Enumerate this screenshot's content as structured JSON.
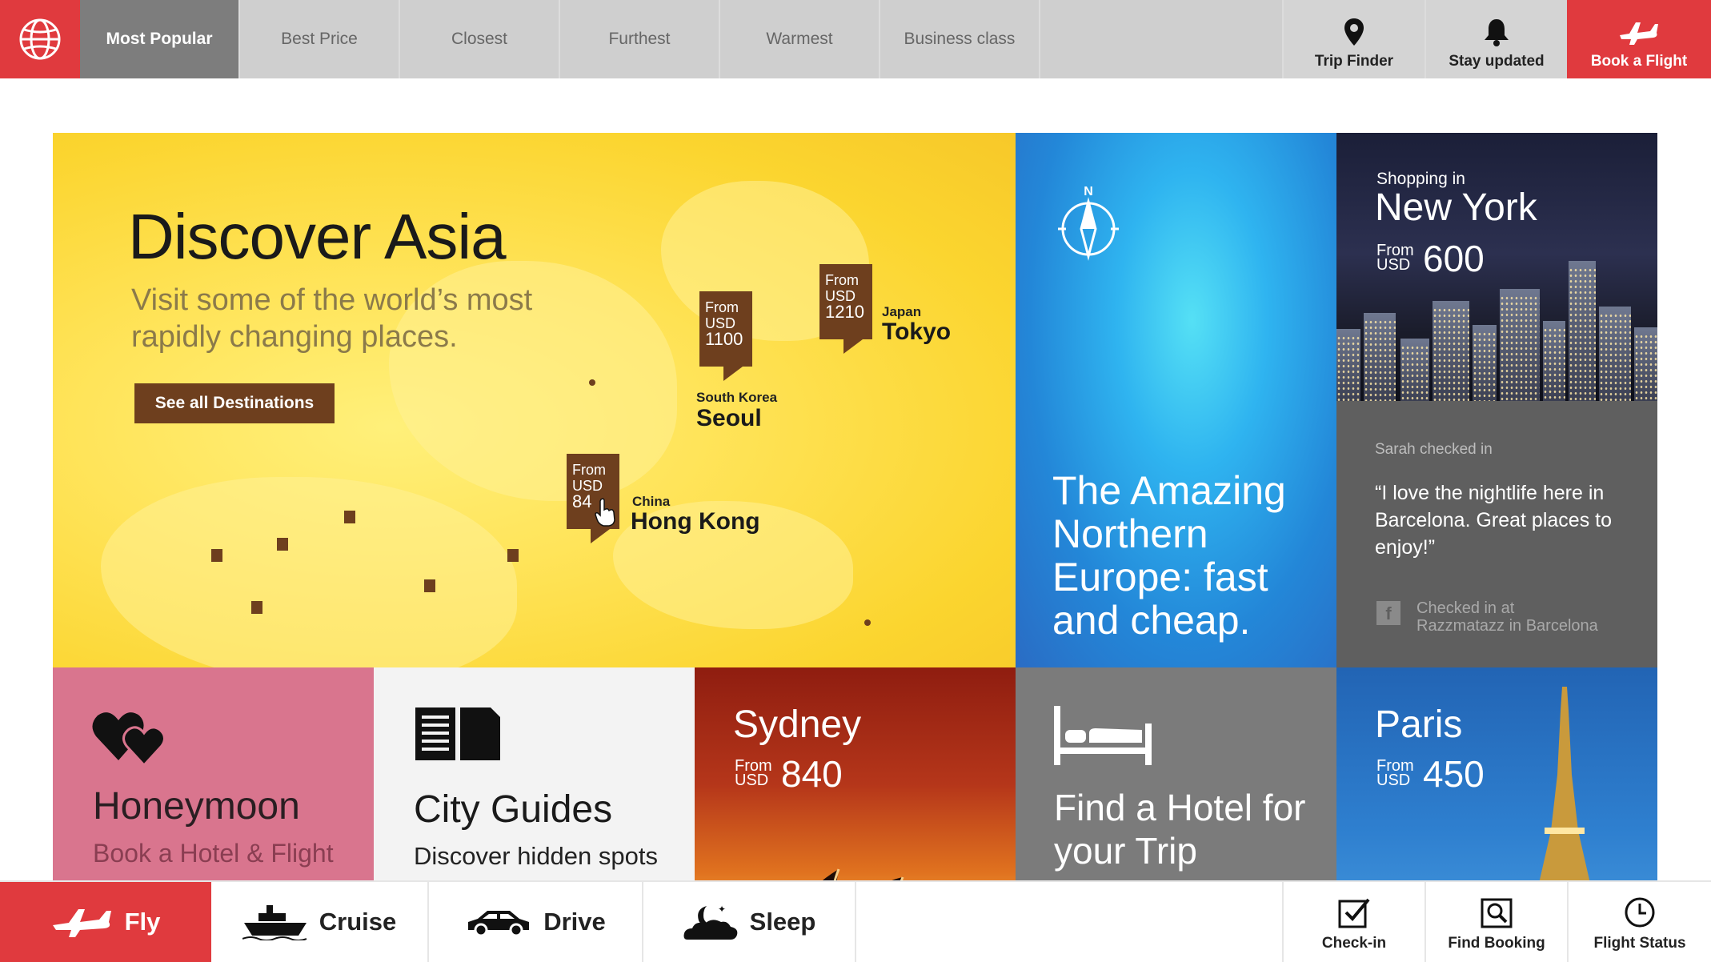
{
  "topbar": {
    "tabs": [
      {
        "label": "Most Popular",
        "active": true
      },
      {
        "label": "Best Price"
      },
      {
        "label": "Closest"
      },
      {
        "label": "Furthest"
      },
      {
        "label": "Warmest"
      },
      {
        "label": "Business class"
      }
    ],
    "utilities": [
      {
        "label": "Trip Finder",
        "icon": "map-pin-icon"
      },
      {
        "label": "Stay updated",
        "icon": "bell-icon"
      },
      {
        "label": "Book a Flight",
        "icon": "plane-icon"
      }
    ]
  },
  "asia": {
    "title": "Discover Asia",
    "subtitle": "Visit some of the world’s most rapidly changing places.",
    "button": "See all Destinations",
    "pins": [
      {
        "from": "From",
        "currency": "USD",
        "price": "1100",
        "country": "South Korea",
        "city": "Seoul"
      },
      {
        "from": "From",
        "currency": "USD",
        "price": "1210",
        "country": "Japan",
        "city": "Tokyo"
      },
      {
        "from": "From",
        "currency": "USD",
        "price": "84",
        "country": "China",
        "city": "Hong Kong"
      }
    ]
  },
  "north": {
    "text": "The Amazing Northern Europe: fast and cheap.",
    "compass_letter": "N"
  },
  "new_york": {
    "kicker": "Shopping in",
    "city": "New York",
    "from": "From",
    "currency": "USD",
    "price": "600"
  },
  "checkin": {
    "who": "Sarah checked in",
    "quote": "“I love the nightlife here in Barcelona. Great places to enjoy!”",
    "fb": "f",
    "at_line1": "Checked in at",
    "at_line2": "Razzmatazz in Barcelona"
  },
  "honeymoon": {
    "title": "Honeymoon",
    "subtitle": "Book a Hotel & Flight"
  },
  "city_guides": {
    "title": "City Guides",
    "subtitle": "Discover hidden spots"
  },
  "sydney": {
    "city": "Sydney",
    "from": "From",
    "currency": "USD",
    "price": "840"
  },
  "hotel": {
    "title": "Find a Hotel for your Trip"
  },
  "paris": {
    "city": "Paris",
    "from": "From",
    "currency": "USD",
    "price": "450"
  },
  "bottombar": {
    "modes": [
      {
        "label": "Fly",
        "icon": "plane-icon",
        "active": true
      },
      {
        "label": "Cruise",
        "icon": "ship-icon"
      },
      {
        "label": "Drive",
        "icon": "car-icon"
      },
      {
        "label": "Sleep",
        "icon": "moon-cloud-icon"
      }
    ],
    "utilities": [
      {
        "label": "Check-in",
        "icon": "checkbox-icon"
      },
      {
        "label": "Find Booking",
        "icon": "search-booking-icon"
      },
      {
        "label": "Flight Status",
        "icon": "clock-icon"
      }
    ]
  },
  "colors": {
    "accent": "#e03a3e",
    "asia_yellow": "#fbd52f",
    "pin_brown": "#6e3f1e"
  }
}
